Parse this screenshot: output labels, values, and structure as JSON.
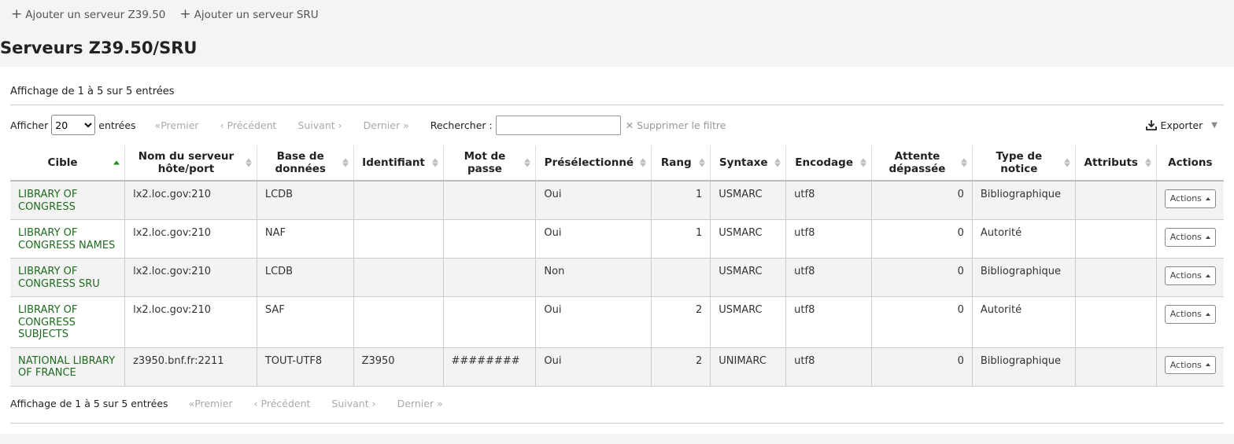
{
  "toolbar": {
    "add_z3950": "Ajouter un serveur Z39.50",
    "add_sru": "Ajouter un serveur SRU"
  },
  "page_title": "Serveurs Z39.50/SRU",
  "table_info": "Affichage de 1 à 5 sur 5 entrées",
  "controls": {
    "show_label": "Afficher",
    "page_size": "20",
    "entries_label": "entrées",
    "first": "Premier",
    "previous": "Précédent",
    "next": "Suivant",
    "last": "Dernier",
    "search_label": "Rechercher :",
    "search_value": "",
    "clear_filter": "Supprimer le filtre",
    "export": "Exporter"
  },
  "columns": [
    {
      "l1": "Cible",
      "l2": ""
    },
    {
      "l1": "Nom du serveur",
      "l2": "hôte/port"
    },
    {
      "l1": "Base de",
      "l2": "données"
    },
    {
      "l1": "Identifiant",
      "l2": ""
    },
    {
      "l1": "Mot de",
      "l2": "passe"
    },
    {
      "l1": "Présélectionné",
      "l2": ""
    },
    {
      "l1": "Rang",
      "l2": ""
    },
    {
      "l1": "Syntaxe",
      "l2": ""
    },
    {
      "l1": "Encodage",
      "l2": ""
    },
    {
      "l1": "Attente",
      "l2": "dépassée"
    },
    {
      "l1": "Type de",
      "l2": "notice"
    },
    {
      "l1": "Attributs",
      "l2": ""
    },
    {
      "l1": "Actions",
      "l2": ""
    }
  ],
  "rows": [
    {
      "target": [
        "LIBRARY OF",
        "CONGRESS"
      ],
      "host": "lx2.loc.gov:210",
      "db": "LCDB",
      "user": "",
      "pass": "",
      "checked": "Oui",
      "rank": "1",
      "syntax": "USMARC",
      "encoding": "utf8",
      "timeout": "0",
      "type": "Bibliographique",
      "attrs": "",
      "action": "Actions"
    },
    {
      "target": [
        "LIBRARY OF",
        "CONGRESS NAMES"
      ],
      "host": "lx2.loc.gov:210",
      "db": "NAF",
      "user": "",
      "pass": "",
      "checked": "Oui",
      "rank": "1",
      "syntax": "USMARC",
      "encoding": "utf8",
      "timeout": "0",
      "type": "Autorité",
      "attrs": "",
      "action": "Actions"
    },
    {
      "target": [
        "LIBRARY OF",
        "CONGRESS SRU"
      ],
      "host": "lx2.loc.gov:210",
      "db": "LCDB",
      "user": "",
      "pass": "",
      "checked": "Non",
      "rank": "",
      "syntax": "USMARC",
      "encoding": "utf8",
      "timeout": "0",
      "type": "Bibliographique",
      "attrs": "",
      "action": "Actions"
    },
    {
      "target": [
        "LIBRARY OF",
        "CONGRESS",
        "SUBJECTS"
      ],
      "host": "lx2.loc.gov:210",
      "db": "SAF",
      "user": "",
      "pass": "",
      "checked": "Oui",
      "rank": "2",
      "syntax": "USMARC",
      "encoding": "utf8",
      "timeout": "0",
      "type": "Autorité",
      "attrs": "",
      "action": "Actions"
    },
    {
      "target": [
        "NATIONAL LIBRARY",
        "OF FRANCE"
      ],
      "host": "z3950.bnf.fr:2211",
      "db": "TOUT-UTF8",
      "user": "Z3950",
      "pass": "########",
      "checked": "Oui",
      "rank": "2",
      "syntax": "UNIMARC",
      "encoding": "utf8",
      "timeout": "0",
      "type": "Bibliographique",
      "attrs": "",
      "action": "Actions"
    }
  ],
  "icons": {
    "add": "plus-icon",
    "clear": "close-icon",
    "export": "download-icon",
    "sort": "sort-icon",
    "dropdown": "caret-up-icon"
  }
}
